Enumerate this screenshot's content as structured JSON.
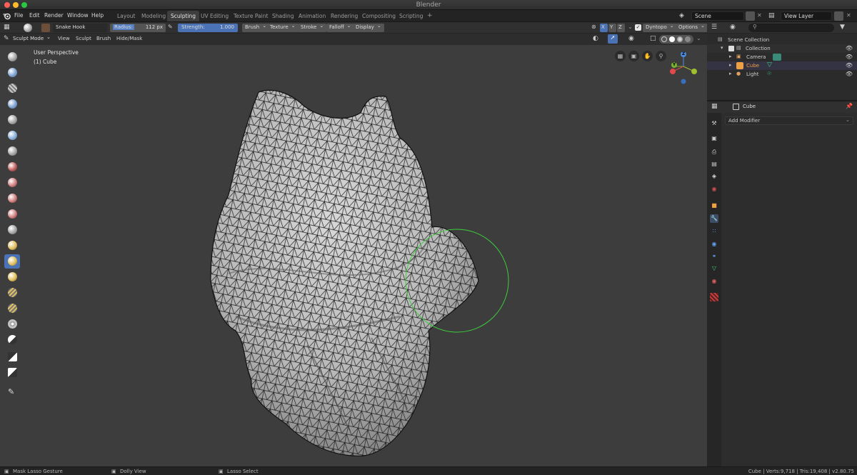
{
  "window": {
    "title": "Blender"
  },
  "menubar": {
    "menus": [
      "File",
      "Edit",
      "Render",
      "Window",
      "Help"
    ],
    "workspaces": [
      "Layout",
      "Modeling",
      "Sculpting",
      "UV Editing",
      "Texture Paint",
      "Shading",
      "Animation",
      "Rendering",
      "Compositing",
      "Scripting"
    ],
    "active_workspace": "Sculpting",
    "add_workspace": "+",
    "scene": "Scene",
    "view_layer": "View Layer"
  },
  "tool_header": {
    "brush_name": "Snake Hook",
    "radius_label": "Radius:",
    "radius_value": "112 px",
    "strength_label": "Strength:",
    "strength_value": "1.000",
    "dropdowns": [
      "Brush",
      "Texture",
      "Stroke",
      "Falloff",
      "Display"
    ],
    "axes": [
      "X",
      "Y",
      "Z"
    ],
    "dyntopo": "Dyntopo",
    "options": "Options"
  },
  "mode_header": {
    "mode": "Sculpt Mode",
    "menus": [
      "View",
      "Sculpt",
      "Brush",
      "Hide/Mask"
    ]
  },
  "viewport": {
    "perspective": "User Perspective",
    "object": "(1) Cube",
    "gizmo": {
      "z": "Z",
      "y": "Y",
      "x": "X"
    }
  },
  "outliner": {
    "root": "Scene Collection",
    "collection": "Collection",
    "items": [
      {
        "name": "Camera",
        "color": "#e0a060"
      },
      {
        "name": "Cube",
        "color": "#f0a040"
      },
      {
        "name": "Light",
        "color": "#e0a060"
      }
    ]
  },
  "properties": {
    "object_name": "Cube",
    "add_modifier": "Add Modifier"
  },
  "statusbar": {
    "left": "Mask Lasso Gesture",
    "middle": "Dolly View",
    "right": "Lasso Select",
    "stats": "Cube | Verts:9,718 | Tris:19,408 | v2.80.75"
  },
  "colors": {
    "accent": "#4a72b5",
    "brush_circle": "#3ccf3c",
    "viewport_bg": "#3d3d3d"
  }
}
